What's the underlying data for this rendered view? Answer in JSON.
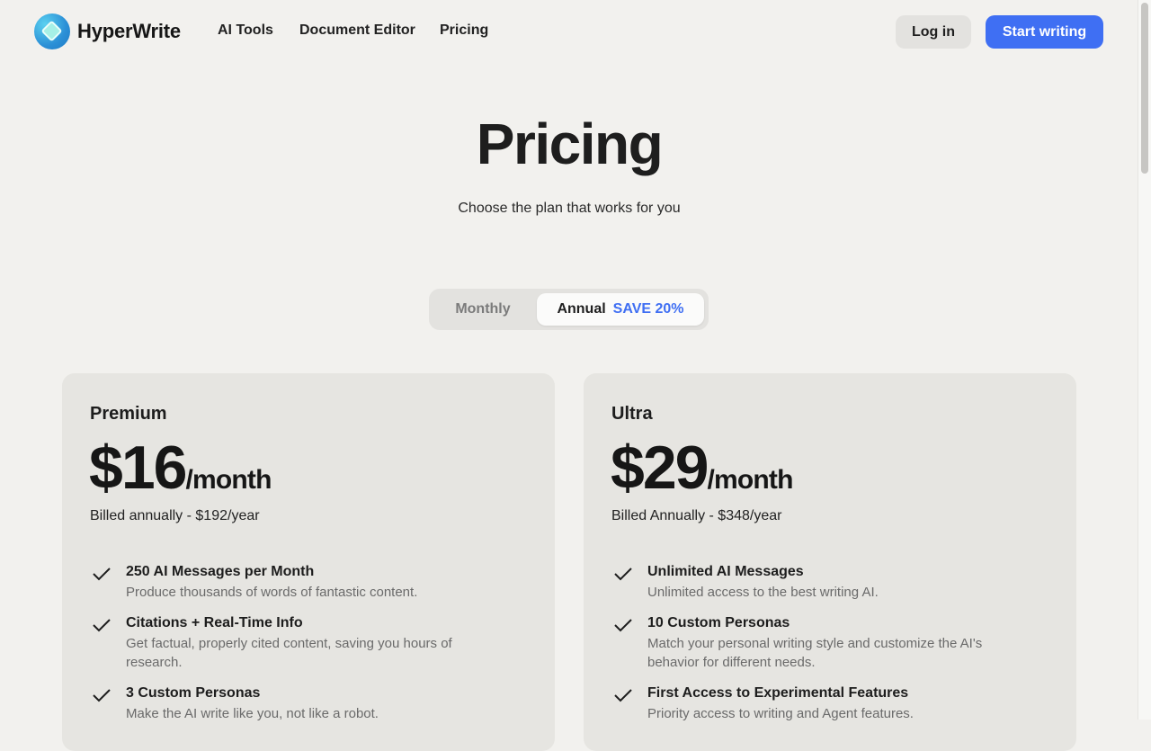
{
  "brand": {
    "name": "HyperWrite"
  },
  "nav": [
    "AI Tools",
    "Document Editor",
    "Pricing"
  ],
  "header_actions": {
    "login": "Log in",
    "start": "Start writing"
  },
  "hero": {
    "title": "Pricing",
    "subtitle": "Choose the plan that works for you"
  },
  "billing_toggle": {
    "monthly": "Monthly",
    "annual": "Annual",
    "save": "SAVE 20%",
    "selected": "Annual"
  },
  "plans": [
    {
      "name": "Premium",
      "price": "$16",
      "per": "/month",
      "billed": "Billed annually - $192/year",
      "features": [
        {
          "title": "250 AI Messages per Month",
          "desc": "Produce thousands of words of fantastic content."
        },
        {
          "title": "Citations + Real-Time Info",
          "desc": "Get factual, properly cited content, saving you hours of research."
        },
        {
          "title": "3 Custom Personas",
          "desc": "Make the AI write like you, not like a robot."
        }
      ]
    },
    {
      "name": "Ultra",
      "price": "$29",
      "per": "/month",
      "billed": "Billed Annually - $348/year",
      "features": [
        {
          "title": "Unlimited AI Messages",
          "desc": "Unlimited access to the best writing AI."
        },
        {
          "title": "10 Custom Personas",
          "desc": "Match your personal writing style and customize the AI's behavior for different needs."
        },
        {
          "title": "First Access to Experimental Features",
          "desc": "Priority access to writing and Agent features."
        }
      ]
    }
  ],
  "colors": {
    "accent": "#3f6ff3",
    "background": "#f2f1ee",
    "card": "#e6e5e1"
  }
}
